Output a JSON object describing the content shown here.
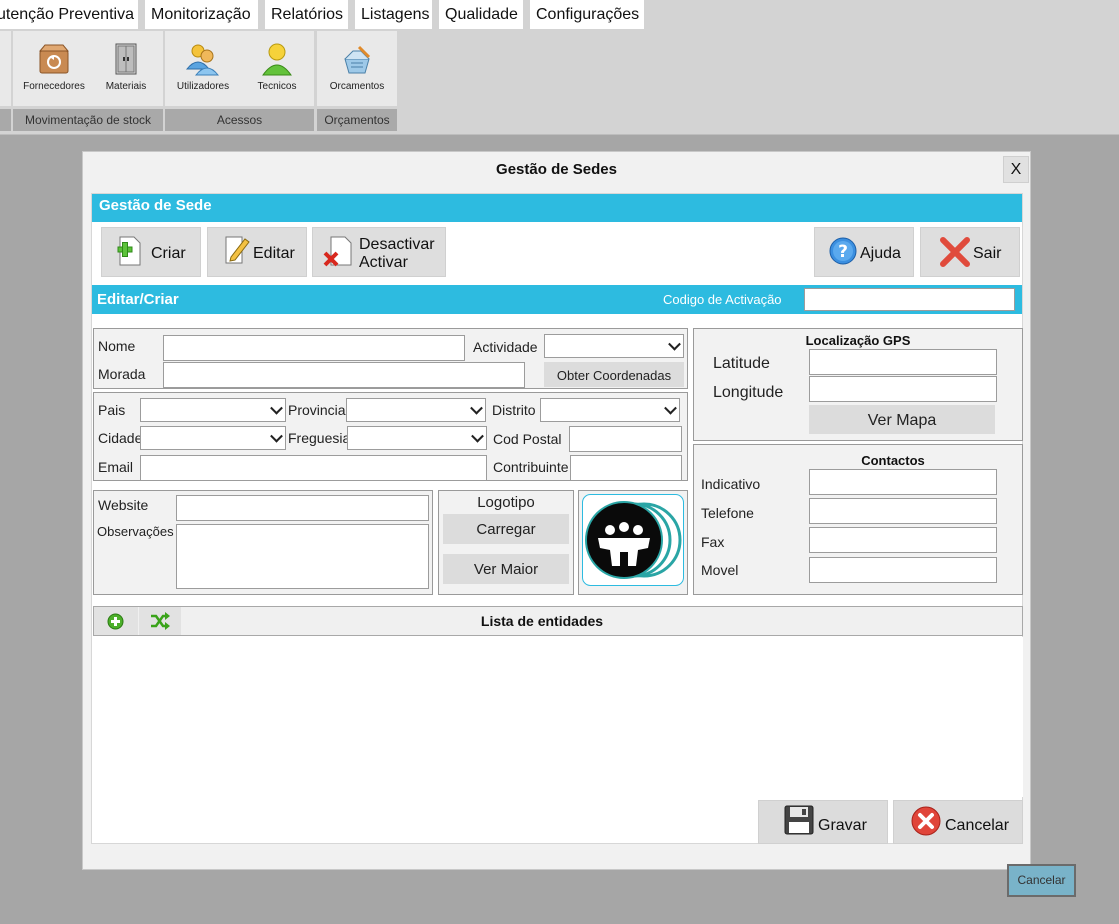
{
  "menu": {
    "tabs": [
      "utenção Preventiva",
      "Monitorização",
      "Relatórios",
      "Listagens",
      "Qualidade",
      "Configurações"
    ]
  },
  "ribbon": {
    "buttons": {
      "fornecedores": "Fornecedores",
      "materiais": "Materiais",
      "utilizadores": "Utilizadores",
      "tecnicos": "Tecnicos",
      "orcamentos": "Orcamentos"
    },
    "groups": [
      "Movimentação de stock",
      "Acessos",
      "Orçamentos"
    ]
  },
  "dialog": {
    "title": "Gestão de Sedes",
    "close": "X",
    "header": "Gestão de Sede",
    "toolbar": {
      "criar": "Criar",
      "editar": "Editar",
      "desactivar": "Desactivar",
      "activar": "Activar",
      "ajuda": "Ajuda",
      "sair": "Sair"
    },
    "edit_bar": {
      "title": "Editar/Criar",
      "activation_label": "Codigo de Activação",
      "activation_value": ""
    },
    "form": {
      "nome": "Nome",
      "actividade": "Actividade",
      "morada": "Morada",
      "obter_coordenadas": "Obter Coordenadas",
      "pais": "Pais",
      "provincia": "Provincia",
      "distrito": "Distrito",
      "cidade": "Cidade",
      "freguesia": "Freguesia",
      "cod_postal": "Cod Postal",
      "email": "Email",
      "contribuinte": "Contribuinte",
      "website": "Website",
      "observacoes": "Observações"
    },
    "logo": {
      "title": "Logotipo",
      "carregar": "Carregar",
      "ver_maior": "Ver Maior"
    },
    "gps": {
      "title": "Localização GPS",
      "latitude": "Latitude",
      "longitude": "Longitude",
      "ver_mapa": "Ver Mapa"
    },
    "contactos": {
      "title": "Contactos",
      "indicativo": "Indicativo",
      "telefone": "Telefone",
      "fax": "Fax",
      "movel": "Movel"
    },
    "lista": {
      "title": "Lista de entidades"
    },
    "footer": {
      "gravar": "Gravar",
      "cancelar": "Cancelar"
    }
  },
  "status": {
    "cancelar": "Cancelar"
  },
  "colors": {
    "accent": "#2dbbe0",
    "window_bg": "#a6a6a6",
    "ribbon_bg": "#d3d3d3"
  }
}
